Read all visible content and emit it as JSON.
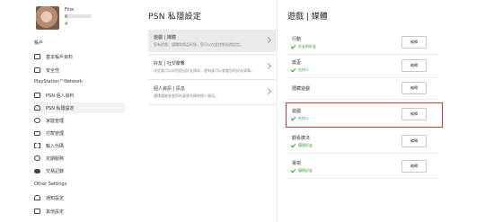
{
  "profile": {
    "name": "Fine",
    "line2": "6",
    "line3": "4"
  },
  "sidebar": {
    "section_account": "帳戶",
    "account_items": [
      {
        "label": "基本帳戶資料",
        "icon": "id-card-icon"
      },
      {
        "label": "安全性",
        "icon": "lock-icon"
      }
    ],
    "section_psn": "PlayStation™Network",
    "psn_items": [
      {
        "label": "PSN 個人資料",
        "icon": "id-card-icon"
      },
      {
        "label": "PSN 私隱設定",
        "icon": "user-lock-icon"
      },
      {
        "label": "家庭管理",
        "icon": "family-icon"
      },
      {
        "label": "付款管理",
        "icon": "credit-card-icon"
      },
      {
        "label": "輸入代碼",
        "icon": "ticket-icon"
      },
      {
        "label": "定期服務",
        "icon": "refresh-icon"
      },
      {
        "label": "交易記錄",
        "icon": "toggle-icon"
      }
    ],
    "section_other": "Other Settings",
    "other_items": [
      {
        "label": "通知設定",
        "icon": "bell-icon"
      },
      {
        "label": "其他設定",
        "icon": "settings-icon"
      }
    ]
  },
  "middle": {
    "title": "PSN 私隱設定",
    "items": [
      {
        "title": "遊戲 | 媒體",
        "desc": "您有遊戲、媒體和獎盃紀錄，您可以在此控制私隱設定。"
      },
      {
        "title": "好友 | 社交聯繫",
        "desc": "決定誰可以向您提出好友請求，還有誰可以查看您的好友清單。"
      },
      {
        "title": "個人資訊 | 訊息",
        "desc": "選擇誰能查看您的真實名稱和個人資訊。"
      }
    ]
  },
  "right": {
    "title": "遊戲 | 媒體",
    "edit_label": "編輯",
    "rows": [
      {
        "name": "行動",
        "value": "好友的好友"
      },
      {
        "name": "獎盃",
        "value": "任何人"
      },
      {
        "name": "隱藏遊戲",
        "value": ""
      },
      {
        "name": "遊戲",
        "value": "任何人"
      },
      {
        "name": "觀看廣法",
        "value": "僅限好友"
      },
      {
        "name": "電視",
        "value": "僅限好友"
      }
    ]
  }
}
